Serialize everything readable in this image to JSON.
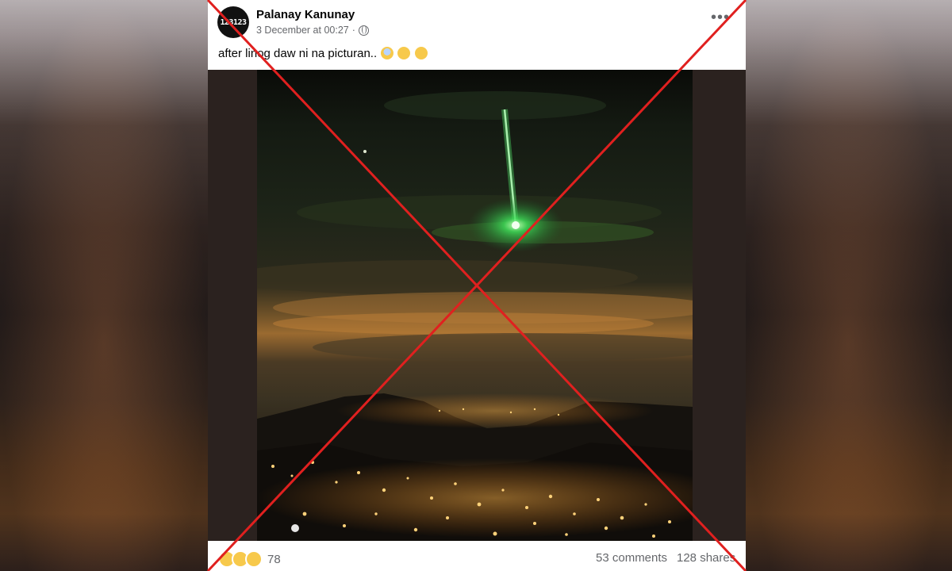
{
  "post": {
    "author": "Palanay Kanunay",
    "avatar_text": "123123",
    "timestamp": "3 December at 00:27",
    "separator": "·",
    "privacy_icon": "globe-icon",
    "more_icon": "more-options-icon",
    "caption": "after linog daw ni na picturan..",
    "caption_emojis": [
      "scream-emoji",
      "crying-emoji",
      "sad-emoji"
    ]
  },
  "photo": {
    "description_icon": "photo-meteor-night-sky"
  },
  "engagement": {
    "reaction_icons": [
      "haha-reaction-icon",
      "wow-reaction-icon",
      "sad-reaction-icon"
    ],
    "reaction_count": "78",
    "comments": "53 comments",
    "shares": "128 shares"
  },
  "overlay": {
    "mark": "red-x-mark",
    "color": "#e0201f"
  }
}
